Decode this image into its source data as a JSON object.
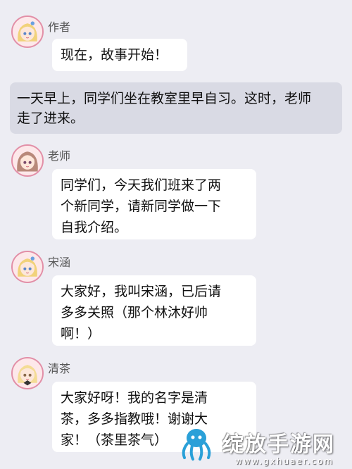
{
  "messages": [
    {
      "name": "作者",
      "text": "现在，故事开始！"
    },
    {
      "name": "老师",
      "text": "同学们，今天我们班来了两\n个新同学，请新同学做一下\n自我介绍。"
    },
    {
      "name": "宋涵",
      "text": "大家好，我叫宋涵，已后请\n多多关照（那个林沐好帅\n啊！）"
    },
    {
      "name": "清茶",
      "text": "大家好呀！我的名字是清\n茶，多多指教哦！谢谢大\n家！（茶里茶气）"
    }
  ],
  "narration": "一天早上，同学们坐在教室里早自习。这时，老师\n走了进来。",
  "watermark": {
    "title": "绽放手游网",
    "url": "www.gxhuaer.com"
  },
  "colors": {
    "background": "#ededf3",
    "bubble": "#ffffff",
    "narration_bg": "#d9dae4",
    "avatar_border": "#e28fa7"
  }
}
